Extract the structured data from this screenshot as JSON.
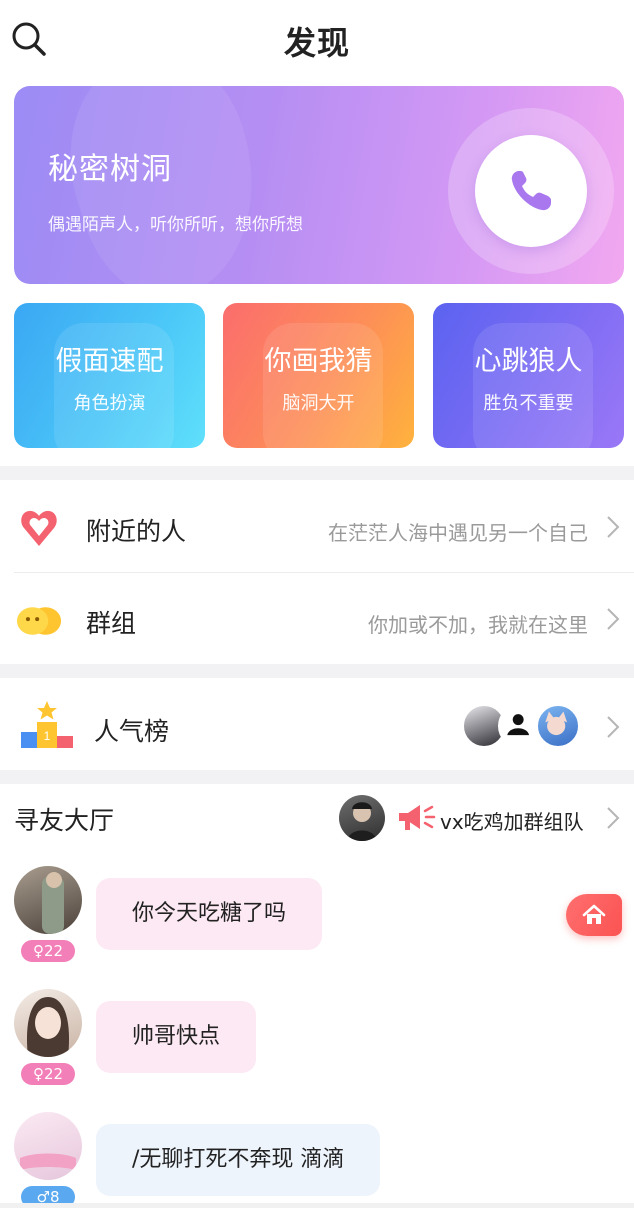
{
  "header": {
    "title": "发现"
  },
  "banner": {
    "title": "秘密树洞",
    "subtitle": "偶遇陌声人，听你所听，想你所想"
  },
  "cards": [
    {
      "title": "假面速配",
      "subtitle": "角色扮演"
    },
    {
      "title": "你画我猜",
      "subtitle": "脑洞大开"
    },
    {
      "title": "心跳狼人",
      "subtitle": "胜负不重要"
    }
  ],
  "list": {
    "nearby": {
      "label": "附近的人",
      "hint": "在茫茫人海中遇见另一个自己"
    },
    "groups": {
      "label": "群组",
      "hint": "你加或不加，我就在这里"
    },
    "ranking": {
      "label": "人气榜"
    }
  },
  "hall": {
    "title": "寻友大厅",
    "notice": "vx吃鸡加群组队",
    "messages": [
      {
        "gender_age": "♀22",
        "text": "你今天吃糖了吗"
      },
      {
        "gender_age": "♀22",
        "text": "帅哥快点"
      },
      {
        "gender_age": "♂8",
        "text": "/无聊打死不奔现 滴滴"
      }
    ]
  },
  "colors": {
    "banner": "#b58ef3",
    "card_1": "#4cc8f8",
    "card_2": "#fd8e58",
    "card_3": "#7d6cf4",
    "female_tag": "#f37fb8",
    "male_tag": "#5aa8ef",
    "home_button": "#fb5353"
  },
  "icons": [
    "search-icon",
    "phone-icon",
    "heart-pin-icon",
    "group-face-icon",
    "podium-icon",
    "megaphone-icon",
    "chevron-right-icon",
    "home-icon"
  ]
}
